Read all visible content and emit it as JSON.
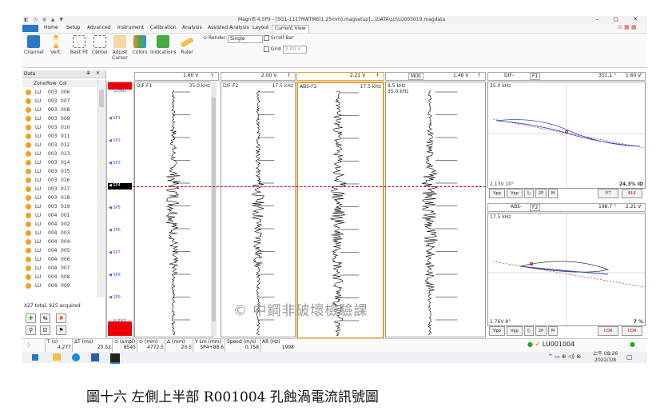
{
  "titlebar": {
    "title": "Magnifi 4 SP9 - [SG1-1117RWTM6(1.25mm).magsetup]...\\DATA\\LU\\LU003019.magdata"
  },
  "menu": [
    "Home",
    "Setup",
    "Advanced",
    "Instrument",
    "Calibration",
    "Analysis",
    "Assisted Analysis",
    "Layout",
    "Current View"
  ],
  "menu_active": "Current View",
  "ribbon": {
    "buttons": [
      "Channel",
      "Vert.",
      "Best Fit",
      "Center",
      "Adjust Cursor",
      "Colors",
      "Indications",
      "Ruler"
    ],
    "render_label": "Render:",
    "render_value": "Single",
    "scroll_bar": "Scroll Bar",
    "grid": "Grid",
    "grid_value": "2.00 V"
  },
  "left_panel": {
    "title": "Data",
    "columns": [
      "Zone",
      "Row",
      "Col"
    ],
    "rows": [
      [
        "LU",
        "003",
        "006"
      ],
      [
        "LU",
        "003",
        "007"
      ],
      [
        "LU",
        "003",
        "008"
      ],
      [
        "LU",
        "003",
        "009"
      ],
      [
        "LU",
        "003",
        "010"
      ],
      [
        "LU",
        "003",
        "011"
      ],
      [
        "LU",
        "003",
        "012"
      ],
      [
        "LU",
        "003",
        "013"
      ],
      [
        "LU",
        "003",
        "014"
      ],
      [
        "LU",
        "003",
        "015"
      ],
      [
        "LU",
        "003",
        "016"
      ],
      [
        "LU",
        "003",
        "017"
      ],
      [
        "LU",
        "003",
        "018"
      ],
      [
        "LU",
        "003",
        "019"
      ],
      [
        "LU",
        "004",
        "001"
      ],
      [
        "LU",
        "004",
        "002"
      ],
      [
        "LU",
        "004",
        "003"
      ],
      [
        "LU",
        "004",
        "004"
      ],
      [
        "LU",
        "004",
        "005"
      ],
      [
        "LU",
        "004",
        "006"
      ],
      [
        "LU",
        "004",
        "007"
      ],
      [
        "LU",
        "004",
        "008"
      ],
      [
        "LU",
        "004",
        "009"
      ]
    ],
    "footer": "X27 total, 925 acquired"
  },
  "markers": [
    "SP1",
    "SP2",
    "SP3",
    "SP4",
    "SP5",
    "SP6",
    "SP7",
    "SP8",
    "SP9"
  ],
  "marker_top": "S-END",
  "marker_bottom": "N-END",
  "channels": [
    {
      "name": "DIF-F1",
      "freq": "35.0 kHz",
      "volt": "1.60 V"
    },
    {
      "name": "DIF-F2",
      "freq": "17.5 kHz",
      "volt": "2.00 V"
    },
    {
      "name": "ABS-F2",
      "freq": "17.5 kHz",
      "volt": "2.21 V"
    },
    {
      "name": "8.5 kHz",
      "freq": "35.0 kHz",
      "volt": "1.48 V",
      "mode": "MIXI"
    }
  ],
  "lissajous_top": {
    "channel": "DIF-",
    "sub": "F1",
    "angle": "351.1 °",
    "volt": "1.60 V",
    "freq": "35.0 kHz",
    "reading": "2.13V 10°",
    "percent": "24.3% ID",
    "buttons": [
      "Vpp",
      "Vpp",
      "↻",
      "2P",
      "M"
    ],
    "fit": "FIT",
    "blk": "BLK"
  },
  "lissajous_bottom": {
    "channel": "ABS-",
    "sub": "F2",
    "angle": "198.7 °",
    "volt": "2.21 V",
    "freq": "17.5 kHz",
    "reading": "1.76V 8°",
    "percent": "7 %",
    "buttons": [
      "Vpp",
      "Vpp",
      "↻",
      "2P",
      "M"
    ],
    "cor1": "COR",
    "cor2": "COR"
  },
  "status": [
    {
      "label": "T (s)",
      "value": "4.277"
    },
    {
      "label": "ΔT (ms)",
      "value": "20.52"
    },
    {
      "label": "⊙ (smpl)",
      "value": "8545"
    },
    {
      "label": "⊙ (mm)",
      "value": "4772.5"
    },
    {
      "label": "Δ (mm)",
      "value": "20.5"
    },
    {
      "label": "Y Lm (mm)",
      "value": "SP4+88.6"
    },
    {
      "label": "Speed (m/s)",
      "value": "0.758"
    },
    {
      "label": "AR (Hz)",
      "value": "1998"
    }
  ],
  "file_status": "LU001004",
  "watermark": "© 中鋼非破壞檢驗課",
  "clock": {
    "time": "上午 08:26",
    "date": "2022/3/8"
  },
  "caption": "圖十六 左側上半部 R001004 孔蝕渦電流訊號圖",
  "colors": {
    "accent": "#2b78c6",
    "highlight": "#f0a020",
    "cursor": "#cc0000",
    "red_block": "#ee0000"
  }
}
